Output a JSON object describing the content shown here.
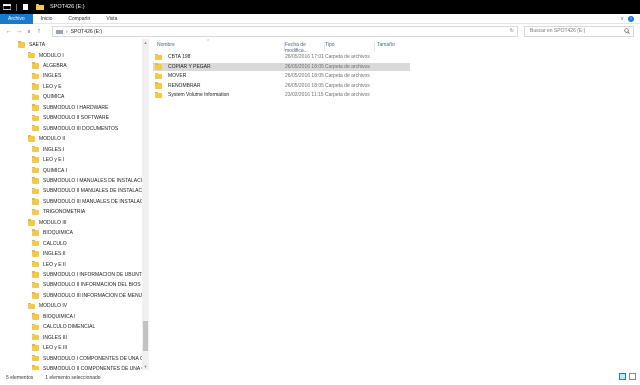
{
  "window": {
    "title": "SPOT426 (E:)"
  },
  "ribbon": {
    "tabs": [
      {
        "label": "Archivo",
        "active": true
      },
      {
        "label": "Inicio",
        "active": false
      },
      {
        "label": "Compartir",
        "active": false
      },
      {
        "label": "Vista",
        "active": false
      }
    ],
    "help": "?"
  },
  "address": {
    "path": "SPOT426 (E:)",
    "search_placeholder": "Buscar en SPOT426 (E:)"
  },
  "navpane": {
    "items": [
      {
        "label": "SAETA",
        "indent": 0
      },
      {
        "label": "MODULO I",
        "indent": 1
      },
      {
        "label": "ALGEBRA",
        "indent": 2
      },
      {
        "label": "INGLES",
        "indent": 2
      },
      {
        "label": "LEO y E",
        "indent": 2
      },
      {
        "label": "QUIMICA",
        "indent": 2
      },
      {
        "label": "SUBMODULO I HARDWARE",
        "indent": 2
      },
      {
        "label": "SUBMODULO II SOFTWARE",
        "indent": 2
      },
      {
        "label": "SUBMODULO III DOCUMENTOS",
        "indent": 2
      },
      {
        "label": "MODULO II",
        "indent": 1
      },
      {
        "label": "INGLES I",
        "indent": 2
      },
      {
        "label": "LEO y E I",
        "indent": 2
      },
      {
        "label": "QUIMICA I",
        "indent": 2
      },
      {
        "label": "SUBMODULO I MANUALES DE INSTALACIO",
        "indent": 2
      },
      {
        "label": "SUBMODULO II MANUALES DE INSTALACIO",
        "indent": 2
      },
      {
        "label": "SUBMODULO III MANUALES DE INSTALACIO",
        "indent": 2
      },
      {
        "label": "TRIGONOMETRIA",
        "indent": 2
      },
      {
        "label": "MODULO III",
        "indent": 1
      },
      {
        "label": "BIOQUIMICA",
        "indent": 2
      },
      {
        "label": "CALCULO",
        "indent": 2
      },
      {
        "label": "INGLES II",
        "indent": 2
      },
      {
        "label": "LEO y E II",
        "indent": 2
      },
      {
        "label": "SUBMODULO I INFORMACION DE UBUNTU",
        "indent": 2
      },
      {
        "label": "SUBMODULO II INFORMACION DEL BIOS",
        "indent": 2
      },
      {
        "label": "SUBMODULO III INFORMACION DE  MENU",
        "indent": 2
      },
      {
        "label": "MODULO IV",
        "indent": 1
      },
      {
        "label": "BIOQUIMICA I",
        "indent": 2
      },
      {
        "label": "CALCULO DIMENCIAL",
        "indent": 2
      },
      {
        "label": "INGLES III",
        "indent": 2
      },
      {
        "label": "LEO y E III",
        "indent": 2
      },
      {
        "label": "SUBMODULO I COMPONENTES DE UNA CO",
        "indent": 2
      },
      {
        "label": "SUBMODULO II COMPONENTES DE UNA CO",
        "indent": 2
      }
    ]
  },
  "columns": {
    "name": "Nombre",
    "date": "Fecha de modifica...",
    "type": "Tipo",
    "size": "Tamaño"
  },
  "files": [
    {
      "name": "CBTA 198",
      "date": "26/05/2016 17:01",
      "type": "Carpeta de archivos",
      "selected": false
    },
    {
      "name": "COPIAR Y PEGAR",
      "date": "26/05/2016 18:05",
      "type": "Carpeta de archivos",
      "selected": true
    },
    {
      "name": "MOVER",
      "date": "26/05/2016 18:05",
      "type": "Carpeta de archivos",
      "selected": false
    },
    {
      "name": "RENOMBRAR",
      "date": "26/05/2016 18:05",
      "type": "Carpeta de archivos",
      "selected": false
    },
    {
      "name": "System Volume Information",
      "date": "23/02/2016 11:15",
      "type": "Carpeta de archivos",
      "selected": false
    }
  ],
  "status": {
    "count": "5 elementos",
    "selected": "1 elemento seleccionado"
  },
  "colors": {
    "accent": "#1979ca",
    "folder": "#f2c94c",
    "selected_row": "#d9d9d9"
  }
}
